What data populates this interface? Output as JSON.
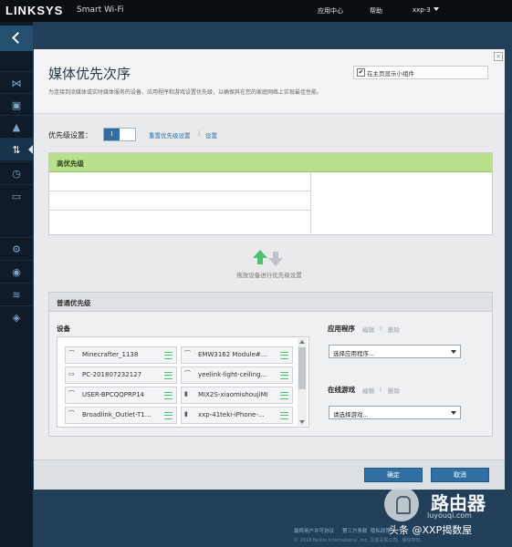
{
  "header": {
    "logo": "LINKSYS",
    "app_name": "Smart Wi-Fi",
    "nav_app_center": "应用中心",
    "nav_help": "帮助",
    "nav_user": "xxp-3"
  },
  "sidebar": {
    "items": [
      {
        "name": "network-map",
        "glyph": "⋈"
      },
      {
        "name": "devices",
        "glyph": "▣"
      },
      {
        "name": "alerts",
        "glyph": "▲"
      },
      {
        "name": "media-prioritization",
        "glyph": "⇅",
        "active": true
      },
      {
        "name": "speed-test",
        "glyph": "◷"
      },
      {
        "name": "external-storage",
        "glyph": "▭"
      },
      {
        "name": "connectivity",
        "glyph": "⚙"
      },
      {
        "name": "troubleshooting",
        "glyph": "◉"
      },
      {
        "name": "wireless",
        "glyph": "≋"
      },
      {
        "name": "security",
        "glyph": "◈"
      }
    ]
  },
  "dialog": {
    "title": "媒体优先次序",
    "description": "为连接到流媒体或实时媒体服务的设备、应用程序和游戏设置优先级，以确保其在您的家庭网络上实现最佳性能。",
    "widget_checkbox_label": "在主页显示小组件",
    "widget_checked": "✔",
    "prio_settings_label": "优先级设置：",
    "toggle_state": "I",
    "reset_link": "重置优先级设置",
    "separator": "|",
    "settings_link": "设置",
    "high_priority_title": "高优先级",
    "drag_hint": "拖放设备进行优先级设置",
    "normal_priority_title": "普通优先级",
    "devices_label": "设备",
    "devices": [
      {
        "name": "Minecrafter_1138",
        "icon": "router-icon"
      },
      {
        "name": "EMW3162 Module#...",
        "icon": "router-icon"
      },
      {
        "name": "PC-201807232127",
        "icon": "monitor-icon"
      },
      {
        "name": "yeelink-light-ceiling...",
        "icon": "router-icon"
      },
      {
        "name": "USER-BPCQQPRP14",
        "icon": "router-icon"
      },
      {
        "name": "MIX2S-xiaomishoujiMI",
        "icon": "phone-icon"
      },
      {
        "name": "Broadlink_Outlet-T1...",
        "icon": "router-icon"
      },
      {
        "name": "xxp-41teki-iPhone-...",
        "icon": "phone-icon"
      }
    ],
    "apps_label": "应用程序",
    "apps_edit": "编辑",
    "apps_delete": "删除",
    "apps_select": "选择应用程序...",
    "games_label": "在线游戏",
    "games_edit": "编辑",
    "games_delete": "删除",
    "games_select": "请选择游戏...",
    "ok_button": "确定",
    "cancel_button": "取消"
  },
  "footer": {
    "link_1": "最终用户许可协议",
    "link_2": "第三方条款",
    "link_3": "隐私政策",
    "copyright": "© 2018 Belkin International, Inc. 及其关联公司。版权所有。"
  },
  "watermark": {
    "cn": "路由器",
    "url": "luyouqi.com",
    "sub": "头条 @XXP揭数屋"
  },
  "colors": {
    "brand_blue": "#2f6fa4",
    "high_priority_green": "#b8e08f",
    "sidebar_bg": "#0f1b28"
  }
}
